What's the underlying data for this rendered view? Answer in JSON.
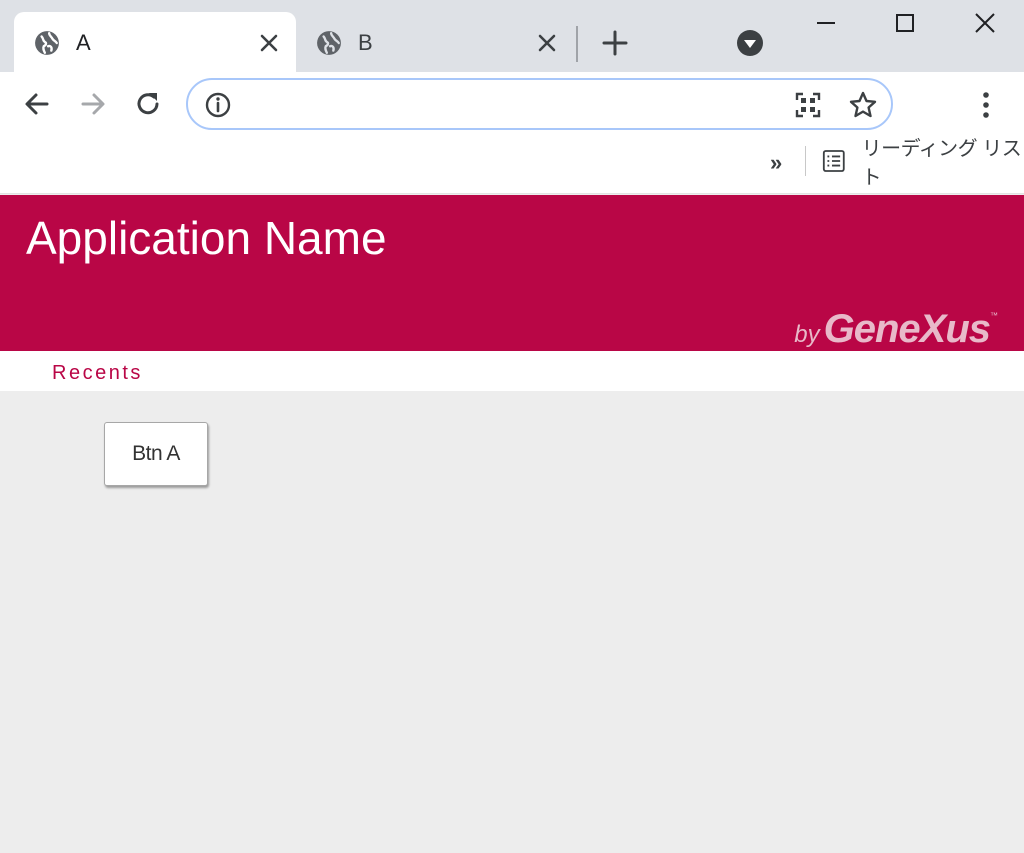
{
  "browser": {
    "tabs": [
      {
        "title": "A",
        "active": true
      },
      {
        "title": "B",
        "active": false
      }
    ],
    "address_bar": {
      "value": "",
      "placeholder": ""
    },
    "bookmarks": {
      "overflow": "»",
      "reading_list_label": "リーディング リスト"
    },
    "icons": [
      "globe-icon",
      "close-icon",
      "plus-icon",
      "tab-search-icon",
      "minimize-icon",
      "maximize-icon",
      "window-close-icon",
      "back-arrow-icon",
      "forward-arrow-icon",
      "reload-icon",
      "info-icon",
      "qr-code-icon",
      "star-icon",
      "more-vert-icon",
      "reading-list-icon"
    ]
  },
  "app": {
    "title": "Application Name",
    "brand": {
      "by": "by",
      "name": "GeneXus",
      "tm": "™"
    },
    "nav": {
      "recents": "Recents"
    },
    "button_label": "Btn A"
  },
  "colors": {
    "header_bg": "#b90646",
    "page_bg": "#ededed",
    "tabstrip_bg": "#dee1e6",
    "accent_text": "#b90646"
  }
}
